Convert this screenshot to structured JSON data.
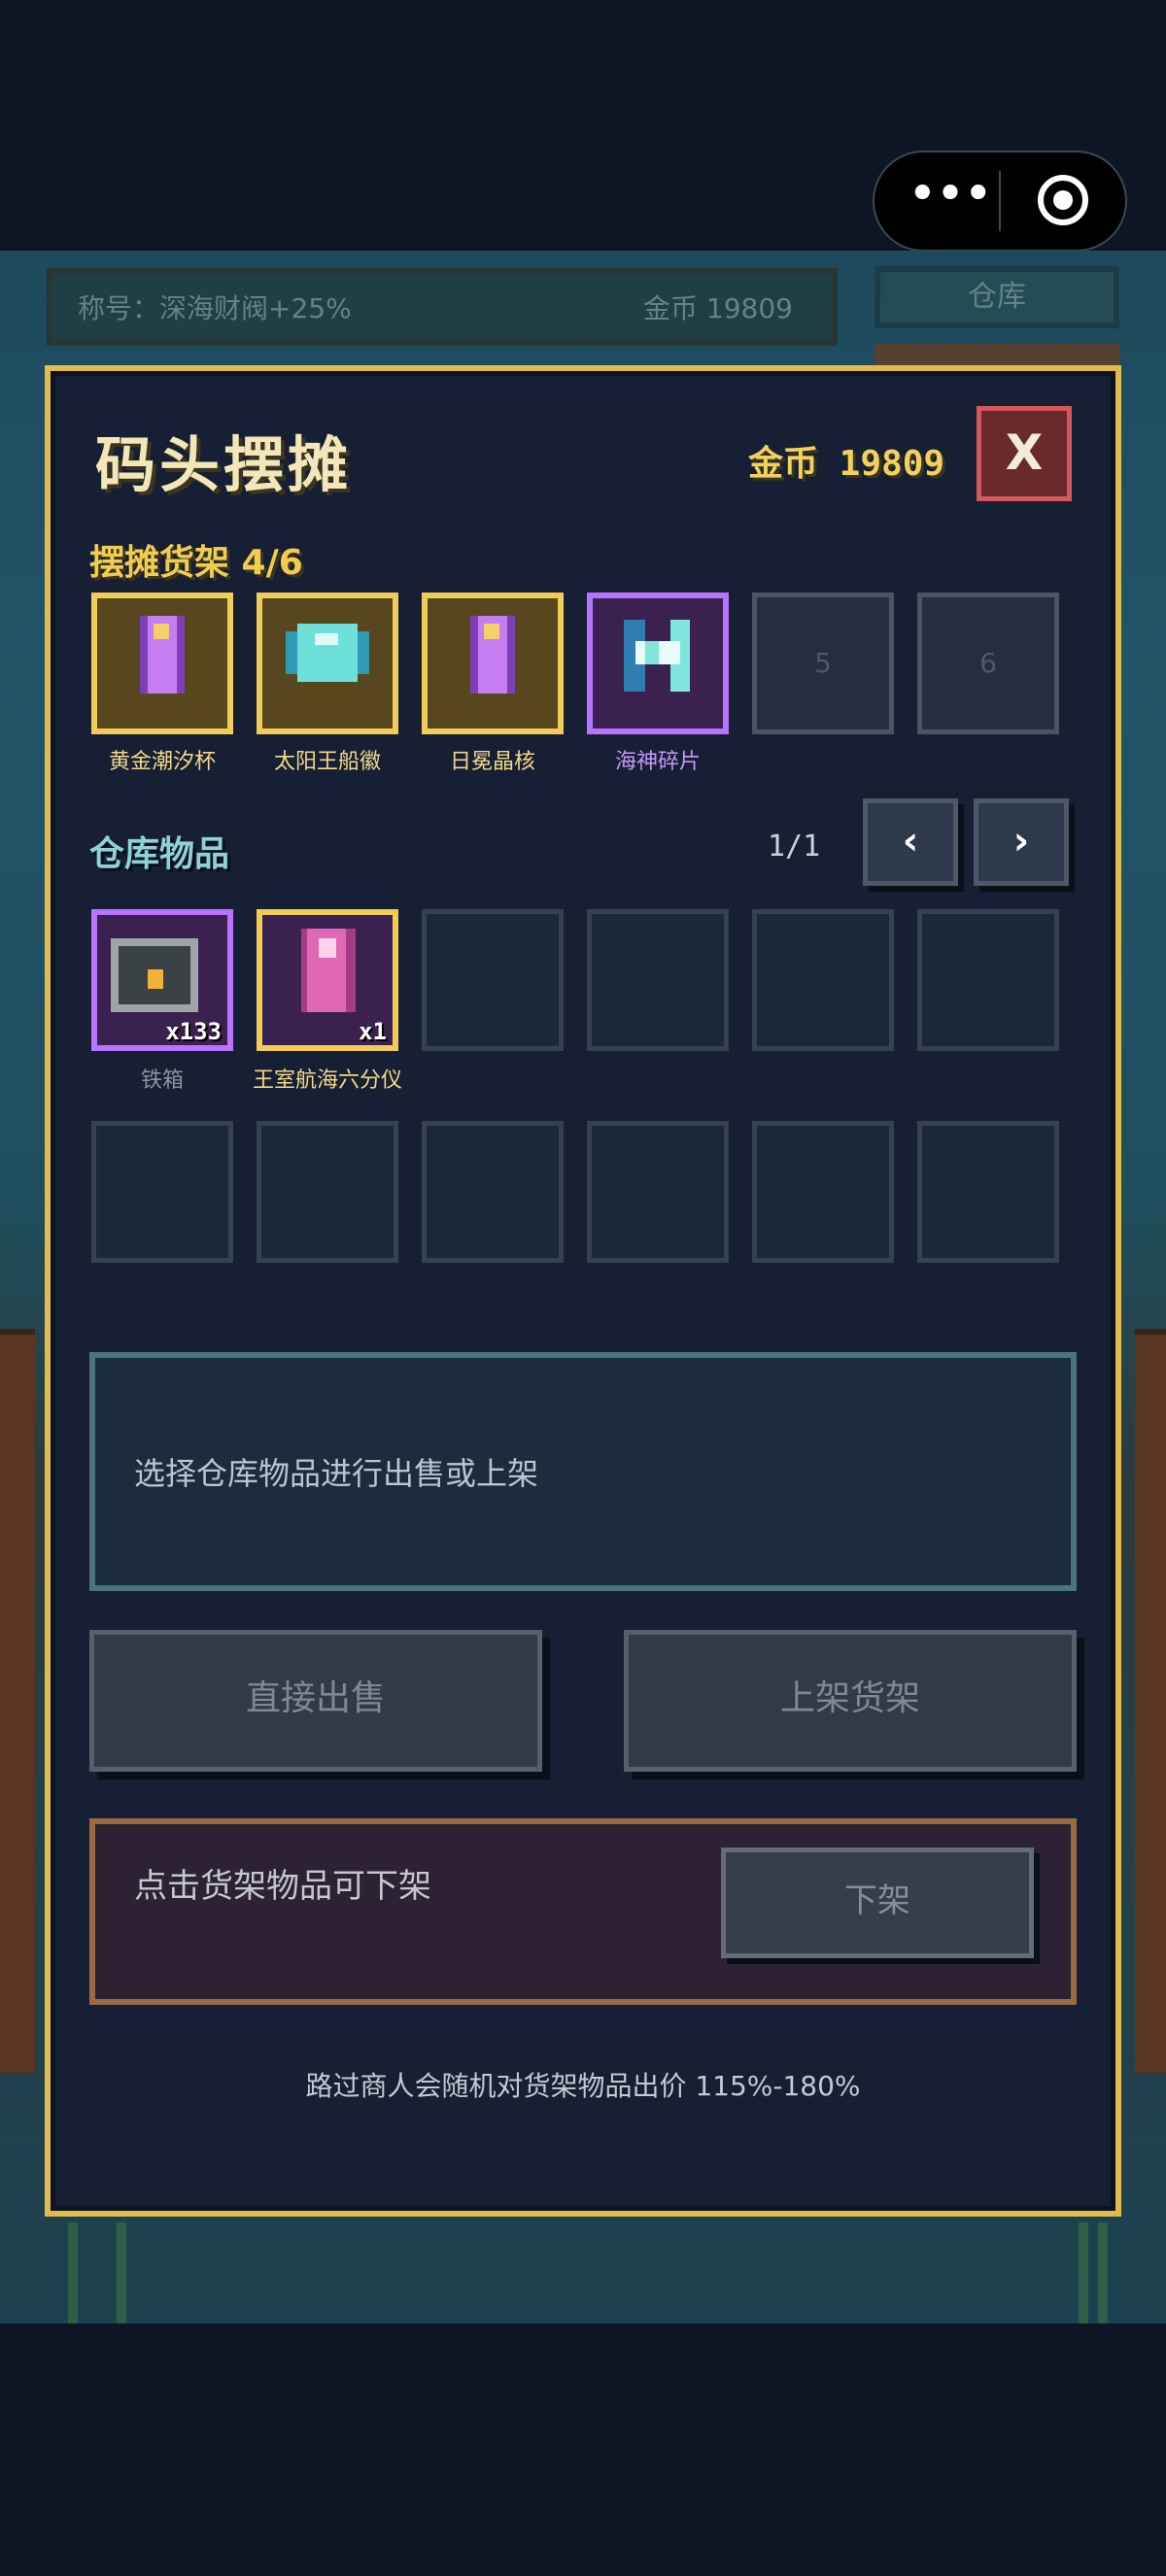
{
  "background": {
    "hud_title": "称号：深海财阀+25%",
    "hud_gold": "金币 19809",
    "hud_button": "仓库"
  },
  "capsule": {
    "more_glyph": "•••"
  },
  "panel": {
    "title": "码头摆摊",
    "gold": "金币 19809",
    "close_label": "X",
    "shelf_label": "摆摊货架 4/6",
    "shelf": [
      {
        "name": "黄金潮汐杯",
        "rarity": "legendary",
        "icon": "golden-tide-cup-icon"
      },
      {
        "name": "太阳王船徽",
        "rarity": "legendary",
        "icon": "sun-king-ship-emblem-icon"
      },
      {
        "name": "日冕晶核",
        "rarity": "legendary",
        "icon": "corona-crystal-core-icon"
      },
      {
        "name": "海神碎片",
        "rarity": "epic",
        "icon": "sea-god-fragment-icon"
      },
      {
        "name": "",
        "slot_number": "5"
      },
      {
        "name": "",
        "slot_number": "6"
      }
    ],
    "warehouse_label": "仓库物品",
    "page": "1/1",
    "prev_label": "‹",
    "next_label": "›",
    "warehouse": [
      {
        "name": "铁箱",
        "qty": "x133",
        "rarity": "epic",
        "icon": "iron-chest-icon"
      },
      {
        "name": "王室航海六分仪",
        "qty": "x1",
        "rarity": "legendary",
        "icon": "royal-sextant-icon"
      }
    ],
    "info_text": "选择仓库物品进行出售或上架",
    "sell_label": "直接出售",
    "list_label": "上架货架",
    "unlist_hint": "点击货架物品可下架",
    "unlist_label": "下架",
    "footer": "路过商人会随机对货架物品出价 115%-180%"
  },
  "colors": {
    "panel_border": "#e3bb4a",
    "legendary": "#f2cd55",
    "epic": "#b874ff",
    "close": "#d4575c"
  }
}
